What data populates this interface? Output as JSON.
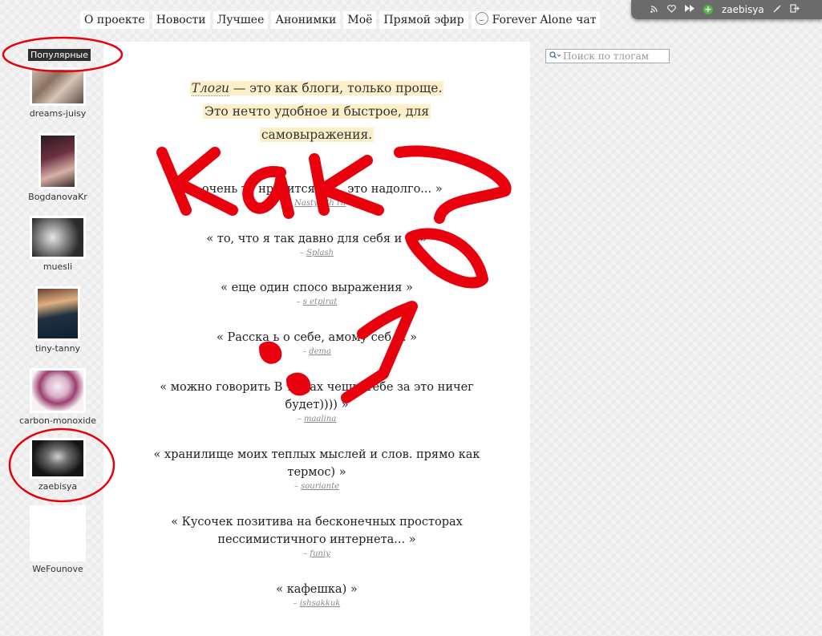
{
  "nav": {
    "items": [
      "О проекте",
      "Новости",
      "Лучшее",
      "Анонимки",
      "Моё",
      "Прямой эфир"
    ],
    "chat_label": "Forever Alone чат"
  },
  "userbar": {
    "icons": [
      "rss-icon",
      "heart-icon",
      "forward-icon",
      "plus-icon"
    ],
    "username": "zaebisya"
  },
  "sidebar": {
    "title": "Популярные",
    "users": [
      {
        "name": "dreams-juisy"
      },
      {
        "name": "BogdanovaKr"
      },
      {
        "name": "muesli"
      },
      {
        "name": "tiny-tanny"
      },
      {
        "name": "carbon-monoxide"
      },
      {
        "name": "zaebisya"
      },
      {
        "name": "WeFounove"
      }
    ]
  },
  "intro": {
    "title": "Тлоги",
    "line1": " — это как блоги, только проще.",
    "line2": "Это нечто удобное и быстрое, для",
    "line3": "самовыражения."
  },
  "quotes": [
    {
      "text": "« очень ту нравится. ду , это надолго... »",
      "author": "NastyaCh rn"
    },
    {
      "text": "« то, что я так давно для себя и а. »",
      "author": "Splash"
    },
    {
      "text": "« еще один спосо выражения »",
      "author": "s etpirat"
    },
    {
      "text": "« Расска ь о себе, амому себ ... »",
      "author": "dema"
    },
    {
      "text": "« можно говорить В то зах чешь, тебе за это ничег будет)))) »",
      "author": "maalina"
    },
    {
      "text": "« хранилище моих теплых мыслей и слов. прямо как термос) »",
      "author": "souriante"
    },
    {
      "text": "« Кусочек позитива на бесконечных просторах пессимистичного интернета... »",
      "author": "funiy"
    },
    {
      "text": "« кафешка) »",
      "author": "ishsakkuk"
    }
  ],
  "search": {
    "placeholder": "Поиск по тлогам"
  },
  "annotation": {
    "color": "#e8000d"
  }
}
